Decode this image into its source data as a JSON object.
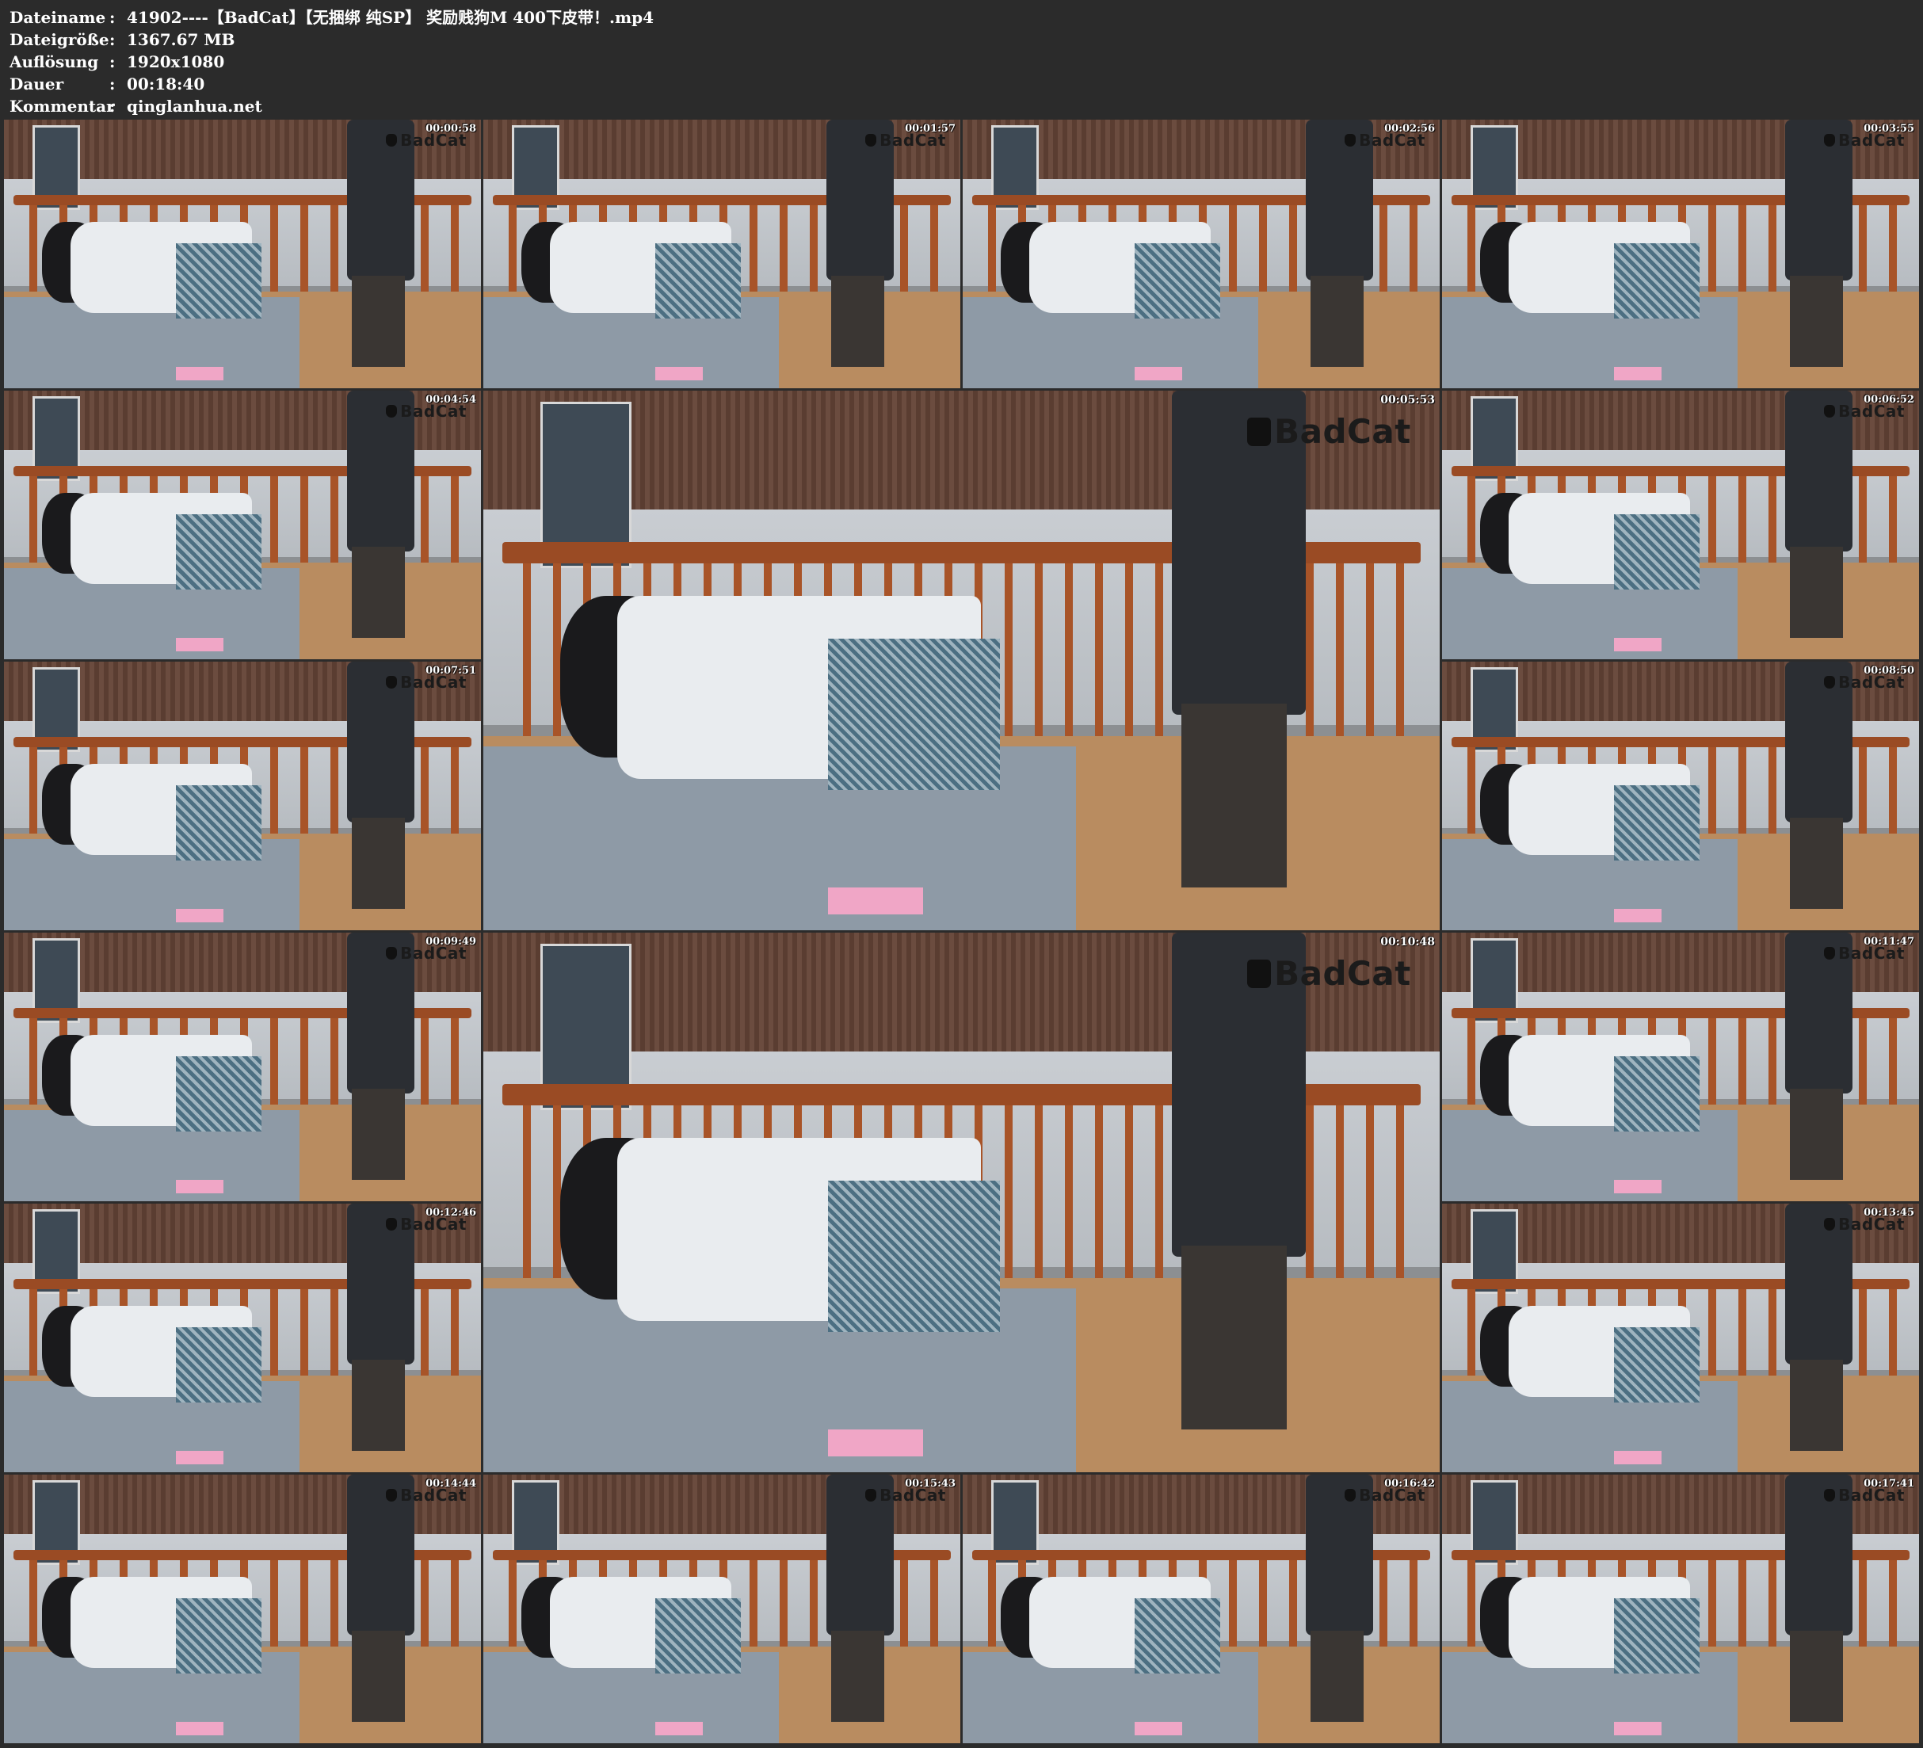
{
  "info": {
    "rows": [
      {
        "key": "Dateiname",
        "sep": ":",
        "value": "41902----【BadCat】【无捆绑 纯SP】 奖励贱狗M 400下皮带！.mp4"
      },
      {
        "key": "Dateigröße",
        "sep": ":",
        "value": "1367.67 MB"
      },
      {
        "key": "Auflösung",
        "sep": ":",
        "value": "1920x1080"
      },
      {
        "key": "Dauer",
        "sep": ":",
        "value": "00:18:40"
      },
      {
        "key": "Kommentar",
        "sep": ":",
        "value": "qinglanhua.net"
      }
    ]
  },
  "logo_text": "BadCat",
  "thumbnails": [
    {
      "timestamp": "00:00:58"
    },
    {
      "timestamp": "00:01:57"
    },
    {
      "timestamp": "00:02:56"
    },
    {
      "timestamp": "00:03:55"
    },
    {
      "timestamp": "00:04:54"
    },
    {
      "timestamp": "00:05:53"
    },
    {
      "timestamp": "00:06:52"
    },
    {
      "timestamp": "00:07:51"
    },
    {
      "timestamp": "00:08:50"
    },
    {
      "timestamp": "00:09:49"
    },
    {
      "timestamp": "00:10:48"
    },
    {
      "timestamp": "00:11:47"
    },
    {
      "timestamp": "00:12:46"
    },
    {
      "timestamp": "00:13:45"
    },
    {
      "timestamp": "00:14:44"
    },
    {
      "timestamp": "00:15:43"
    },
    {
      "timestamp": "00:16:42"
    },
    {
      "timestamp": "00:17:41"
    }
  ]
}
